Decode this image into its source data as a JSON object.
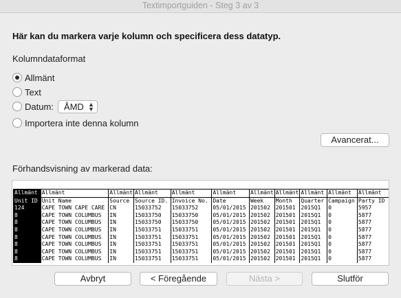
{
  "window": {
    "title": "Textimportguiden - Steg 3 av 3"
  },
  "heading": "Här kan du markera varje kolumn och specificera dess datatyp.",
  "format": {
    "label": "Kolumndataformat",
    "options": [
      {
        "label": "Allmänt",
        "selected": true
      },
      {
        "label": "Text",
        "selected": false
      },
      {
        "label": "Datum:",
        "selected": false
      },
      {
        "label": "Importera inte denna kolumn",
        "selected": false
      }
    ],
    "date_format": "ÅMD"
  },
  "advanced_button": "Avancerat...",
  "preview": {
    "label": "Förhandsvisning av markerad data:",
    "type_row": [
      "Allmänt",
      "Allmänt",
      "Allmänt",
      "Allmänt",
      "Allmänt",
      "Allmänt",
      "Allmänt",
      "Allmänt",
      "Allmänt",
      "Allmänt",
      "Allmänt"
    ],
    "columns": [
      "Unit ID",
      "Unit Name",
      "Source",
      "Source ID.",
      "Invoice No.",
      "Date",
      "Week",
      "Month",
      "Quarter",
      "Campaign",
      "Party ID"
    ],
    "rows": [
      [
        "124",
        "CAPE TOWN CAPE CARE",
        "CN",
        "15033752",
        "15033752",
        "05/01/2015",
        "201502",
        "201501",
        "2015Q1",
        "0",
        "5957"
      ],
      [
        "8",
        "CAPE TOWN COLUMBUS",
        "IN",
        "15033750",
        "15033750",
        "05/01/2015",
        "201502",
        "201501",
        "2015Q1",
        "0",
        "5877"
      ],
      [
        "8",
        "CAPE TOWN COLUMBUS",
        "IN",
        "15033750",
        "15033750",
        "05/01/2015",
        "201502",
        "201501",
        "2015Q1",
        "0",
        "5877"
      ],
      [
        "8",
        "CAPE TOWN COLUMBUS",
        "IN",
        "15033751",
        "15033751",
        "05/01/2015",
        "201502",
        "201501",
        "2015Q1",
        "0",
        "5877"
      ],
      [
        "8",
        "CAPE TOWN COLUMBUS",
        "IN",
        "15033751",
        "15033751",
        "05/01/2015",
        "201502",
        "201501",
        "2015Q1",
        "0",
        "5877"
      ],
      [
        "8",
        "CAPE TOWN COLUMBUS",
        "IN",
        "15033751",
        "15033751",
        "05/01/2015",
        "201502",
        "201501",
        "2015Q1",
        "0",
        "5877"
      ],
      [
        "8",
        "CAPE TOWN COLUMBUS",
        "IN",
        "15033751",
        "15033751",
        "05/01/2015",
        "201502",
        "201501",
        "2015Q1",
        "0",
        "5877"
      ],
      [
        "8",
        "CAPE TOWN COLUMBUS",
        "IN",
        "15033751",
        "15033751",
        "05/01/2015",
        "201502",
        "201501",
        "2015Q1",
        "0",
        "5877"
      ]
    ]
  },
  "buttons": {
    "cancel": "Avbryt",
    "back": "< Föregående",
    "next": "Nästa >",
    "finish": "Slutför"
  }
}
